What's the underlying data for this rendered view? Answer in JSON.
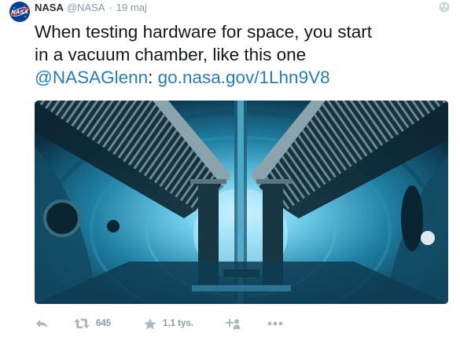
{
  "tweet": {
    "author_name": "NASA",
    "author_handle": "@NASA",
    "separator": "·",
    "timestamp": "19 maj",
    "text_line1": "When testing hardware for space, you start",
    "text_line2": "in a vacuum chamber, like this one",
    "mention": "@NASAGlenn",
    "link": "go.nasa.gov/1Lhn9V8"
  },
  "actions": {
    "retweet_count": "645",
    "favorite_count": "1,1 tys."
  },
  "icons": {
    "avatar": "nasa-meatball-logo",
    "visibility": "globe-icon",
    "reply": "reply-icon",
    "retweet": "retweet-icon",
    "favorite": "star-icon",
    "follow": "add-user-icon",
    "more": "more-icon"
  },
  "colors": {
    "link": "#2b7bb9",
    "muted": "#8899a6",
    "icon": "#aab8c2",
    "text": "#14171a"
  }
}
